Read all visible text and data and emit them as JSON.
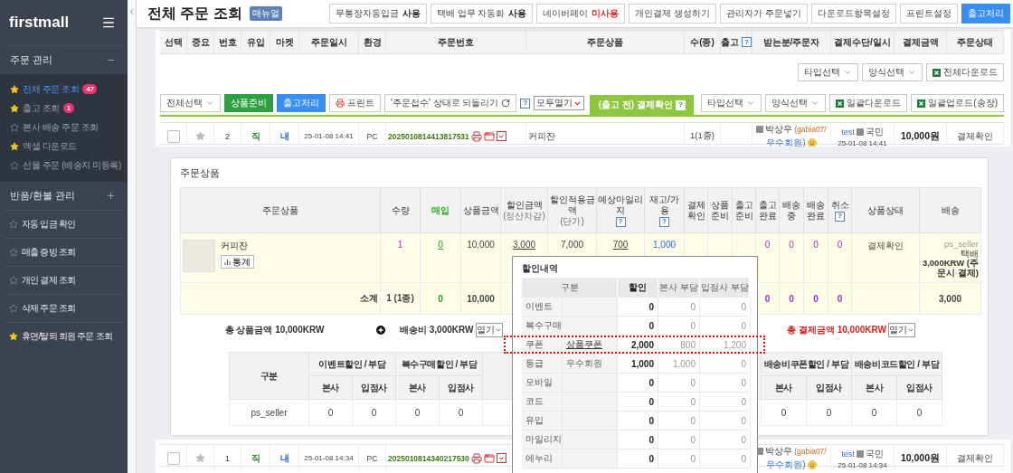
{
  "sidebar": {
    "logo": "firstmall",
    "menu": [
      {
        "kind": "group",
        "title": "주문 관리",
        "expanded": true,
        "items": [
          {
            "label": "전체 주문 조회",
            "starred": true,
            "selected": true,
            "badge": "47"
          },
          {
            "label": "출고 조회",
            "starred": true,
            "selected": false,
            "badge": "1"
          },
          {
            "label": "본사 배송 주문 조회",
            "starred": false,
            "selected": false
          },
          {
            "label": "엑셀 다운로드",
            "starred": true,
            "selected": false
          },
          {
            "label": "선물 주문 (배송지 미등록)",
            "starred": false,
            "selected": false
          }
        ]
      },
      {
        "kind": "group",
        "title": "반품/환불 관리",
        "expanded": false
      },
      {
        "kind": "link",
        "label": "자동 입금 확인",
        "starred": false
      },
      {
        "kind": "link",
        "label": "매출 증빙 조회",
        "starred": false
      },
      {
        "kind": "link",
        "label": "개인 결제 조회",
        "starred": false
      },
      {
        "kind": "link",
        "label": "삭제 주문 조회",
        "starred": false
      },
      {
        "kind": "link",
        "label": "휴면/탈퇴 회원 주문 조회",
        "starred": true
      }
    ]
  },
  "header": {
    "title": "전체 주문 조회",
    "manual": "매뉴얼",
    "buttons": [
      {
        "kind": "setting",
        "label": "무통장자동입금",
        "status": "사용",
        "enabled": true
      },
      {
        "kind": "setting",
        "label": "택배 업무 자동화",
        "status": "사용",
        "enabled": true
      },
      {
        "kind": "setting",
        "label": "네이버페이",
        "status": "미사용",
        "enabled": false
      },
      {
        "kind": "plain",
        "label": "개인결제 생성하기"
      },
      {
        "kind": "plain",
        "label": "관리자가 주문넣기"
      },
      {
        "kind": "plain",
        "label": "다운로드항목설정"
      },
      {
        "kind": "plain",
        "label": "프린트설정"
      },
      {
        "kind": "primary",
        "label": "출고처리"
      }
    ]
  },
  "order_columns": [
    {
      "label": "선택"
    },
    {
      "label": "중요"
    },
    {
      "label": "번호"
    },
    {
      "label": "유입"
    },
    {
      "label": "마켓"
    },
    {
      "label": "주문일시"
    },
    {
      "label": "환경"
    },
    {
      "label": "주문번호"
    },
    {
      "label": "주문상품"
    },
    {
      "label": "수(종)"
    },
    {
      "label": "출고",
      "help": "?"
    },
    {
      "label": "받는분/주문자"
    },
    {
      "label": "결제수단/일시"
    },
    {
      "label": "결제금액"
    },
    {
      "label": "주문상태"
    }
  ],
  "top_actions": [
    {
      "kind": "select",
      "label": "타입선택"
    },
    {
      "kind": "select",
      "label": "양식선택"
    },
    {
      "kind": "excel",
      "label": "전체다운로드"
    }
  ],
  "toolbar": {
    "left": [
      {
        "kind": "select",
        "label": "전체선택"
      },
      {
        "kind": "green",
        "label": "상품준비"
      },
      {
        "kind": "blue",
        "label": "출고처리"
      },
      {
        "kind": "print",
        "label": "프린트"
      },
      {
        "kind": "revert",
        "label": "'주문접수' 상태로 되돌리기"
      },
      {
        "kind": "help",
        "label": "?"
      },
      {
        "kind": "mini-select",
        "label": "모두열기"
      }
    ],
    "tab": {
      "label": "(출고 전) 결제확인",
      "help": "?"
    },
    "right": [
      {
        "kind": "select",
        "label": "타입선택"
      },
      {
        "kind": "select",
        "label": "양식선택"
      },
      {
        "kind": "excel",
        "label": "일괄다운로드"
      },
      {
        "kind": "excel",
        "label": "일괄업로드(송장)"
      }
    ]
  },
  "orders": [
    {
      "checked": false,
      "important": false,
      "number": "2",
      "inflow": "직",
      "market": "내",
      "date": "25-01-08 14:41",
      "env": "PC",
      "order_no": "2025010814413817531",
      "product": "커피잔",
      "quantity": "1(1종)",
      "receiver": "박상우",
      "member_id": "(gabia07/",
      "grade": "우수회원)",
      "payer": "test",
      "bank": "국민",
      "paid_at": "25-01-08 14:41",
      "amount": "10,000원",
      "status": "결제확인",
      "expanded": true
    },
    {
      "checked": false,
      "important": false,
      "number": "1",
      "inflow": "직",
      "market": "내",
      "date": "25-01-08 14:34",
      "env": "PC",
      "order_no": "2025010814340217530",
      "receiver": "박상우",
      "member_id": "(gabia07/",
      "grade": "우수회원)",
      "payer": "test",
      "bank": "국민",
      "paid_at": "25-01-08 14:34",
      "amount": "10,000원",
      "status": "결제확인",
      "expanded": false
    }
  ],
  "order_detail": {
    "title": "주문상품",
    "columns": [
      {
        "label": "주문상품"
      },
      {
        "label": "수량"
      },
      {
        "label": "매입",
        "kind": "accent"
      },
      {
        "label": "상품금액"
      },
      {
        "label": "할인금액",
        "sub": "(정산차감)"
      },
      {
        "label": "할인적용금액",
        "sub": "(단가)"
      },
      {
        "label": "예상마일리지",
        "help": "?"
      },
      {
        "label": "재고/가용",
        "help": "?"
      },
      {
        "label": "결제확인"
      },
      {
        "label": "상품준비"
      },
      {
        "label": "출고준비"
      },
      {
        "label": "출고완료"
      },
      {
        "label": "배송중"
      },
      {
        "label": "배송완료"
      },
      {
        "label": "취소",
        "help": "?"
      },
      {
        "label": "상품상태"
      },
      {
        "label": "배송"
      }
    ],
    "product": {
      "name": "커피잔",
      "stats_button": "통계",
      "cells": [
        {
          "text": "1",
          "kind": "purple"
        },
        {
          "text": "0",
          "kind": "green-link"
        },
        {
          "text": "10,000",
          "kind": "plain"
        },
        {
          "text": "3,000",
          "kind": "link"
        },
        {
          "text": "7,000",
          "kind": "plain"
        },
        {
          "text": "700",
          "kind": "link"
        },
        {
          "text": "1,000",
          "kind": "blue"
        },
        null,
        null,
        null,
        {
          "text": "0",
          "kind": "purple"
        },
        {
          "text": "0",
          "kind": "purple"
        },
        {
          "text": "0",
          "kind": "purple"
        },
        {
          "text": "0",
          "kind": "purple"
        },
        {
          "text": "결제확인",
          "kind": "plain"
        }
      ],
      "shipping": {
        "seller": "ps_seller",
        "method": "택배",
        "fee": "3,000KRW (주문시 결제)"
      }
    },
    "subtotal": {
      "label": "소계",
      "cells": [
        {
          "text": "1 (1종)",
          "kind": "plain"
        },
        {
          "text": "0",
          "kind": "green"
        },
        {
          "text": "10,000",
          "kind": "plain"
        },
        null,
        null,
        null,
        null,
        null,
        null,
        null,
        {
          "text": "0",
          "kind": "purple"
        },
        {
          "text": "0",
          "kind": "purple"
        },
        {
          "text": "0",
          "kind": "purple"
        },
        {
          "text": "0",
          "kind": "purple"
        },
        null,
        {
          "text": "3,000",
          "kind": "plain"
        }
      ]
    },
    "totals": [
      {
        "kind": "amount",
        "label": "총 상품금액",
        "value": "10,000KRW"
      },
      {
        "kind": "plus"
      },
      {
        "kind": "amount",
        "label": "배송비",
        "value": "3,000KRW",
        "toggle": "열기"
      },
      {
        "kind": "grand",
        "label": "총 결제금액",
        "value": "10,000KRW",
        "toggle": "열기"
      }
    ],
    "summary": {
      "header": "구분",
      "row_label": "ps_seller",
      "left_groups": [
        {
          "label": "이벤트할인 / 부담",
          "subs": [
            "본사",
            "입점사"
          ],
          "values": [
            "0",
            "0"
          ]
        },
        {
          "label": "복수구매할인 / 부담",
          "subs": [
            "본사",
            "입점사"
          ],
          "values": [
            "0",
            "0"
          ]
        }
      ],
      "right_groups": [
        {
          "label": "배송비쿠폰할인 / 부담",
          "subs": [
            "본사",
            "입점사"
          ],
          "values": [
            "0",
            "0"
          ]
        },
        {
          "label": "배송비코드할인 / 부담",
          "subs": [
            "본사",
            "입점사"
          ],
          "values": [
            "0",
            "0"
          ]
        }
      ]
    }
  },
  "discount_popup": {
    "title": "할인내역",
    "columns": [
      "구분",
      "할인",
      "본사 부담",
      "입점사 부담"
    ],
    "rows": [
      {
        "type": "이벤트",
        "discount": "0",
        "hq": "0",
        "seller": "0",
        "highlighted": false
      },
      {
        "type": "복수구매",
        "discount": "0",
        "hq": "0",
        "seller": "0",
        "highlighted": false
      },
      {
        "type": "쿠폰",
        "name": "상품쿠폰",
        "linked": true,
        "discount": "2,000",
        "hq": "800",
        "seller": "1,200",
        "highlighted": true
      },
      {
        "type": "등급",
        "name": "우수회원",
        "linked": false,
        "discount": "1,000",
        "hq": "1,000",
        "seller": "0",
        "highlighted": false
      },
      {
        "type": "모바일",
        "discount": "0",
        "hq": "0",
        "seller": "0",
        "highlighted": false
      },
      {
        "type": "코드",
        "discount": "0",
        "hq": "0",
        "seller": "0",
        "highlighted": false
      },
      {
        "type": "유입",
        "discount": "0",
        "hq": "0",
        "seller": "0",
        "highlighted": false
      },
      {
        "type": "마일리지",
        "discount": "0",
        "hq": "0",
        "seller": "0",
        "highlighted": false
      },
      {
        "type": "에누리",
        "discount": "0",
        "hq": "0",
        "seller": "0",
        "highlighted": false
      }
    ]
  }
}
